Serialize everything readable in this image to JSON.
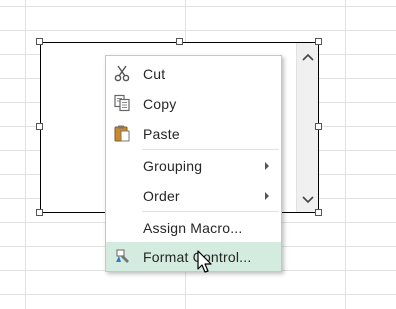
{
  "context_menu": {
    "items": [
      {
        "label": "Cut",
        "icon": "scissors-icon"
      },
      {
        "label": "Copy",
        "icon": "copy-icon"
      },
      {
        "label": "Paste",
        "icon": "clipboard-icon"
      },
      {
        "label": "Grouping",
        "submenu": true
      },
      {
        "label": "Order",
        "submenu": true
      },
      {
        "label": "Assign Macro..."
      },
      {
        "label": "Format Control...",
        "icon": "format-control-icon",
        "highlighted": true
      }
    ]
  },
  "colors": {
    "highlight": "#d3ecdf",
    "gridline": "#e1e1e1",
    "menu_border": "#c6c6c6"
  }
}
